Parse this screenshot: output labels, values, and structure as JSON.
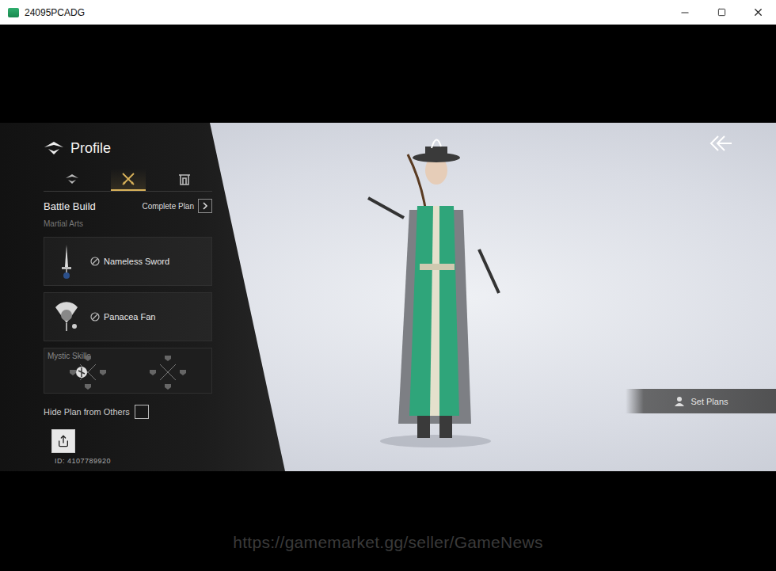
{
  "window": {
    "title": "24095PCADG"
  },
  "profile": {
    "title": "Profile"
  },
  "tabs": [
    {
      "kind": "profile",
      "selected": false
    },
    {
      "kind": "combat",
      "selected": true
    },
    {
      "kind": "gate",
      "selected": false
    }
  ],
  "battle_build": {
    "title": "Battle Build",
    "complete_plan": "Complete Plan",
    "section": "Martial Arts"
  },
  "martial_arts": [
    {
      "name": "Nameless Sword",
      "kind": "sword"
    },
    {
      "name": "Panacea Fan",
      "kind": "fan"
    }
  ],
  "mystic_skills": {
    "label": "Mystic Skills",
    "slots": [
      {
        "filled": true
      },
      {
        "filled": false
      }
    ]
  },
  "hide_plan": {
    "label": "Hide Plan from Others",
    "checked": false
  },
  "player_id": "ID: 4107789920",
  "set_plans": "Set Plans",
  "watermark": "https://gamemarket.gg/seller/GameNews"
}
